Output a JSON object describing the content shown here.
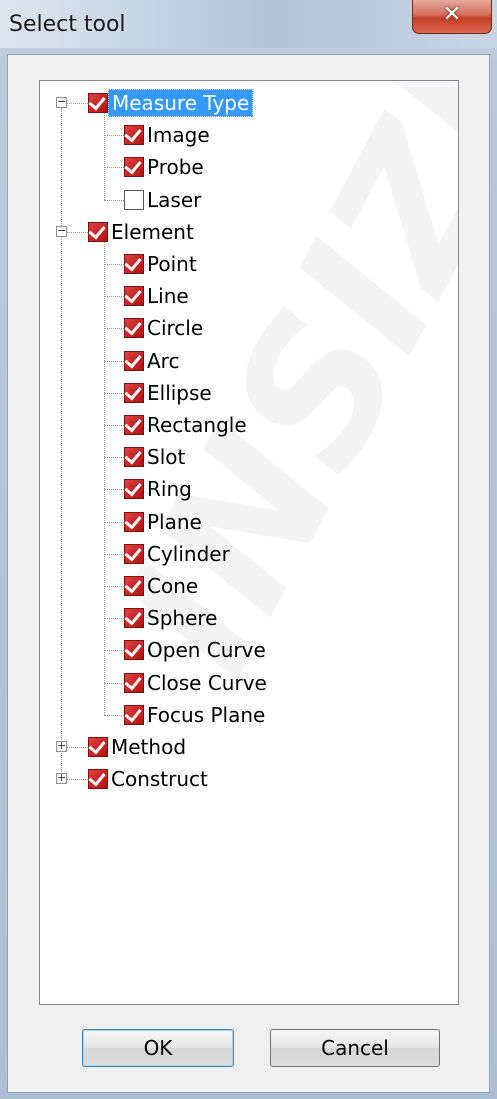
{
  "window": {
    "title": "Select tool"
  },
  "tree": {
    "groups": [
      {
        "label": "Measure Type",
        "checked": true,
        "expanded": true,
        "selected": true,
        "children": [
          {
            "label": "Image",
            "checked": true
          },
          {
            "label": "Probe",
            "checked": true
          },
          {
            "label": "Laser",
            "checked": false
          }
        ]
      },
      {
        "label": "Element",
        "checked": true,
        "expanded": true,
        "selected": false,
        "children": [
          {
            "label": "Point",
            "checked": true
          },
          {
            "label": "Line",
            "checked": true
          },
          {
            "label": "Circle",
            "checked": true
          },
          {
            "label": "Arc",
            "checked": true
          },
          {
            "label": "Ellipse",
            "checked": true
          },
          {
            "label": "Rectangle",
            "checked": true
          },
          {
            "label": "Slot",
            "checked": true
          },
          {
            "label": "Ring",
            "checked": true
          },
          {
            "label": "Plane",
            "checked": true
          },
          {
            "label": "Cylinder",
            "checked": true
          },
          {
            "label": "Cone",
            "checked": true
          },
          {
            "label": "Sphere",
            "checked": true
          },
          {
            "label": "Open Curve",
            "checked": true
          },
          {
            "label": "Close Curve",
            "checked": true
          },
          {
            "label": "Focus Plane",
            "checked": true
          }
        ]
      },
      {
        "label": "Method",
        "checked": true,
        "expanded": false,
        "selected": false,
        "children": []
      },
      {
        "label": "Construct",
        "checked": true,
        "expanded": false,
        "selected": false,
        "children": []
      }
    ]
  },
  "buttons": {
    "ok": "OK",
    "cancel": "Cancel"
  },
  "watermark": "INSIZE"
}
